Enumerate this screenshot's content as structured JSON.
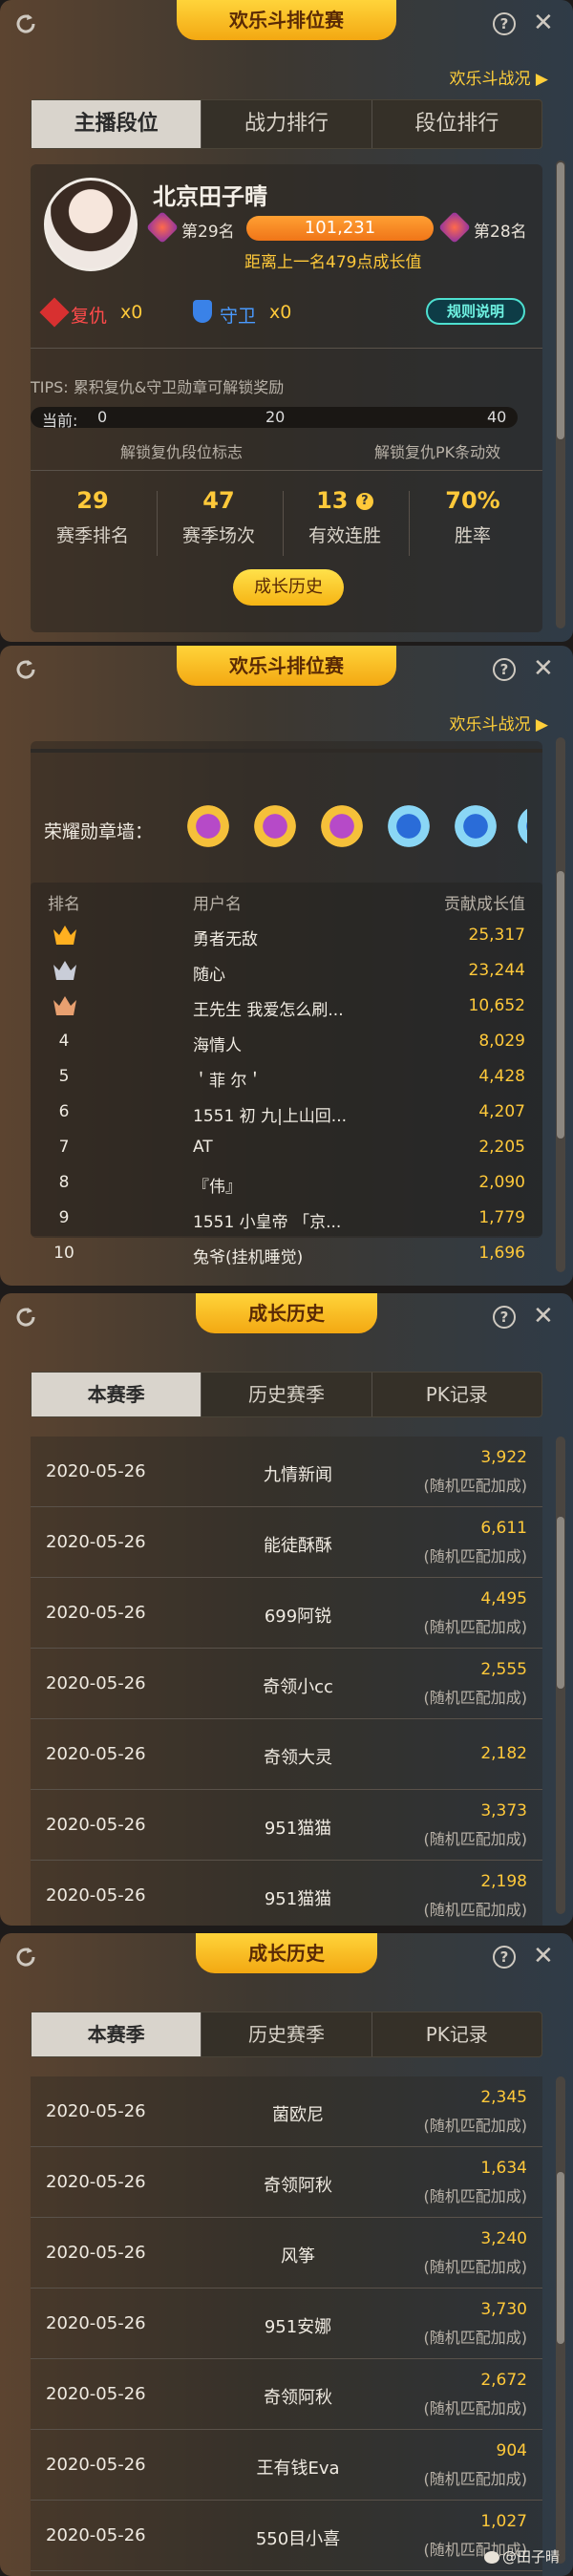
{
  "panel1": {
    "title": "欢乐斗排位赛",
    "battle_link": "欢乐斗战况 ▶",
    "tabs": [
      "主播段位",
      "战力排行",
      "段位排行"
    ],
    "profile": {
      "name": "北京田子晴",
      "rank_left": "第29名",
      "score": "101,231",
      "rank_right": "第28名",
      "gap_text": "距离上一名479点成长值"
    },
    "revenge_label": "复仇",
    "revenge_count": "x0",
    "guard_label": "守卫",
    "guard_count": "x0",
    "rules_btn": "规则说明",
    "tips": "TIPS: 累积复仇&守卫勋章可解锁奖励",
    "progress": {
      "current_label": "当前:",
      "current": "0",
      "mid": "20",
      "end": "40",
      "fraction": 0.0
    },
    "unlock_left": "解锁复仇段位标志",
    "unlock_right": "解锁复仇PK条动效",
    "stats": [
      {
        "value": "29",
        "label": "赛季排名"
      },
      {
        "value": "47",
        "label": "赛季场次"
      },
      {
        "value": "13",
        "label": "有效连胜"
      },
      {
        "value": "70%",
        "label": "胜率"
      }
    ],
    "growth_btn": "成长历史"
  },
  "panel2": {
    "title": "欢乐斗排位赛",
    "battle_link": "欢乐斗战况 ▶",
    "medal_wall": "荣耀勋章墙：",
    "columns": [
      "排名",
      "用户名",
      "贡献成长值"
    ],
    "rows": [
      {
        "rank": "1",
        "user": "勇者无敌",
        "value": "25,317"
      },
      {
        "rank": "2",
        "user": "随心",
        "value": "23,244"
      },
      {
        "rank": "3",
        "user": "王先生 我爱怎么刷...",
        "value": "10,652"
      },
      {
        "rank": "4",
        "user": "海情人",
        "value": "8,029"
      },
      {
        "rank": "5",
        "user": "＇菲 尔＇",
        "value": "4,428"
      },
      {
        "rank": "6",
        "user": "1551 初 九|上山回...",
        "value": "4,207"
      },
      {
        "rank": "7",
        "user": "AT",
        "value": "2,205"
      },
      {
        "rank": "8",
        "user": "『伟』",
        "value": "2,090"
      },
      {
        "rank": "9",
        "user": "1551 小皇帝 「京...",
        "value": "1,779"
      },
      {
        "rank": "10",
        "user": "兔爷(挂机睡觉)",
        "value": "1,696"
      }
    ]
  },
  "panel3": {
    "title": "成长历史",
    "tabs": [
      "本赛季",
      "历史赛季",
      "PK记录"
    ],
    "rows": [
      {
        "date": "2020-05-26",
        "name": "九情新闻",
        "value": "3,922",
        "sub": "(随机匹配加成)"
      },
      {
        "date": "2020-05-26",
        "name": "能徒酥酥",
        "value": "6,611",
        "sub": "(随机匹配加成)"
      },
      {
        "date": "2020-05-26",
        "name": "699阿锐",
        "value": "4,495",
        "sub": "(随机匹配加成)"
      },
      {
        "date": "2020-05-26",
        "name": "奇领小cc",
        "value": "2,555",
        "sub": "(随机匹配加成)"
      },
      {
        "date": "2020-05-26",
        "name": "奇领大灵",
        "value": "2,182",
        "sub": ""
      },
      {
        "date": "2020-05-26",
        "name": "951猫猫",
        "value": "3,373",
        "sub": "(随机匹配加成)"
      },
      {
        "date": "2020-05-26",
        "name": "951猫猫",
        "value": "2,198",
        "sub": "(随机匹配加成)"
      }
    ]
  },
  "panel4": {
    "title": "成长历史",
    "tabs": [
      "本赛季",
      "历史赛季",
      "PK记录"
    ],
    "rows": [
      {
        "date": "2020-05-26",
        "name": "菌欧尼",
        "value": "2,345",
        "sub": "(随机匹配加成)"
      },
      {
        "date": "2020-05-26",
        "name": "奇领阿秋",
        "value": "1,634",
        "sub": "(随机匹配加成)"
      },
      {
        "date": "2020-05-26",
        "name": "风筝",
        "value": "3,240",
        "sub": "(随机匹配加成)"
      },
      {
        "date": "2020-05-26",
        "name": "951安娜",
        "value": "3,730",
        "sub": "(随机匹配加成)"
      },
      {
        "date": "2020-05-26",
        "name": "奇领阿秋",
        "value": "2,672",
        "sub": "(随机匹配加成)"
      },
      {
        "date": "2020-05-26",
        "name": "王有钱Eva",
        "value": "904",
        "sub": "(随机匹配加成)"
      },
      {
        "date": "2020-05-26",
        "name": "550目小喜",
        "value": "1,027",
        "sub": "(随机匹配加成)"
      }
    ],
    "watermark": "@田子晴"
  }
}
